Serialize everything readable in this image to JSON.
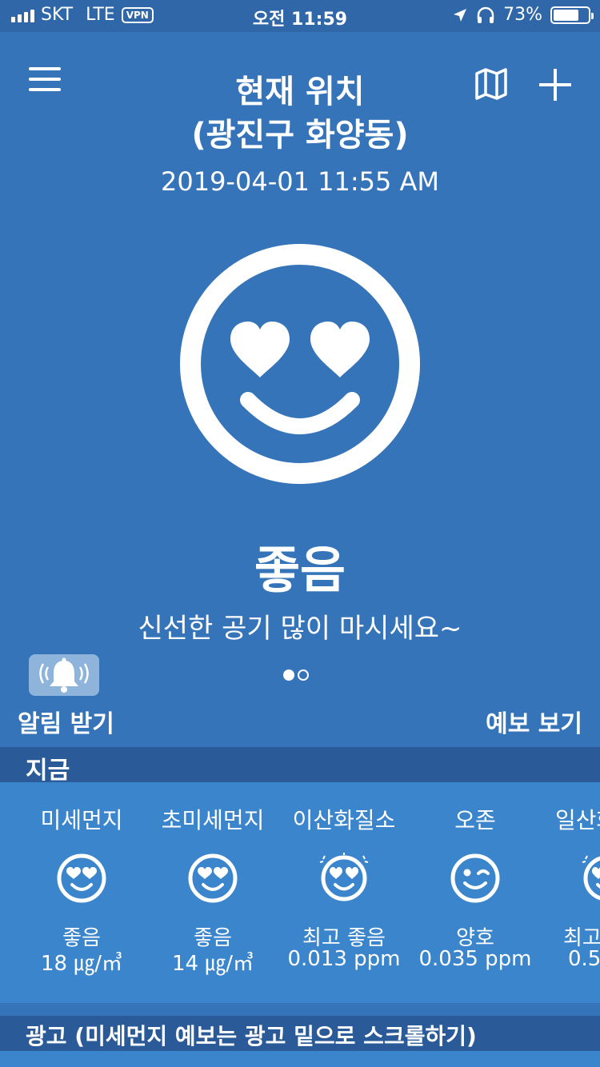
{
  "status_bar": {
    "carrier": "SKT",
    "network": "LTE",
    "vpn": "VPN",
    "time": "오전 11:59",
    "battery": "73%",
    "battery_level": 0.73
  },
  "header": {
    "title_line1": "현재 위치",
    "title_line2": "(광진구 화양동)",
    "datetime": "2019-04-01 11:55 AM"
  },
  "main": {
    "face_icon": "heart-eyes-smile-icon",
    "status_word": "좋음",
    "status_message": "신선한 공기 많이 마시세요~",
    "page_count": 2,
    "active_page": 1
  },
  "actions": {
    "alert_label": "알림 받기",
    "forecast_label": "예보 보기"
  },
  "now_section": {
    "title": "지금",
    "items": [
      {
        "name": "미세먼지",
        "grade": "좋음",
        "value": "18 ㎍/㎥",
        "icon": "heart-eyes-face-icon"
      },
      {
        "name": "초미세먼지",
        "grade": "좋음",
        "value": "14 ㎍/㎥",
        "icon": "heart-eyes-face-icon"
      },
      {
        "name": "이산화질소",
        "grade": "최고 좋음",
        "value": "0.013 ppm",
        "icon": "sparkle-heart-eyes-face-icon"
      },
      {
        "name": "오존",
        "grade": "양호",
        "value": "0.035 ppm",
        "icon": "wink-face-icon"
      },
      {
        "name": "일산화",
        "grade": "최고",
        "value": "0.5",
        "icon": "sparkle-heart-eyes-face-icon"
      }
    ]
  },
  "ad_bar": {
    "text": "광고 (미세먼지 예보는 광고 밑으로 스크롤하기)"
  }
}
